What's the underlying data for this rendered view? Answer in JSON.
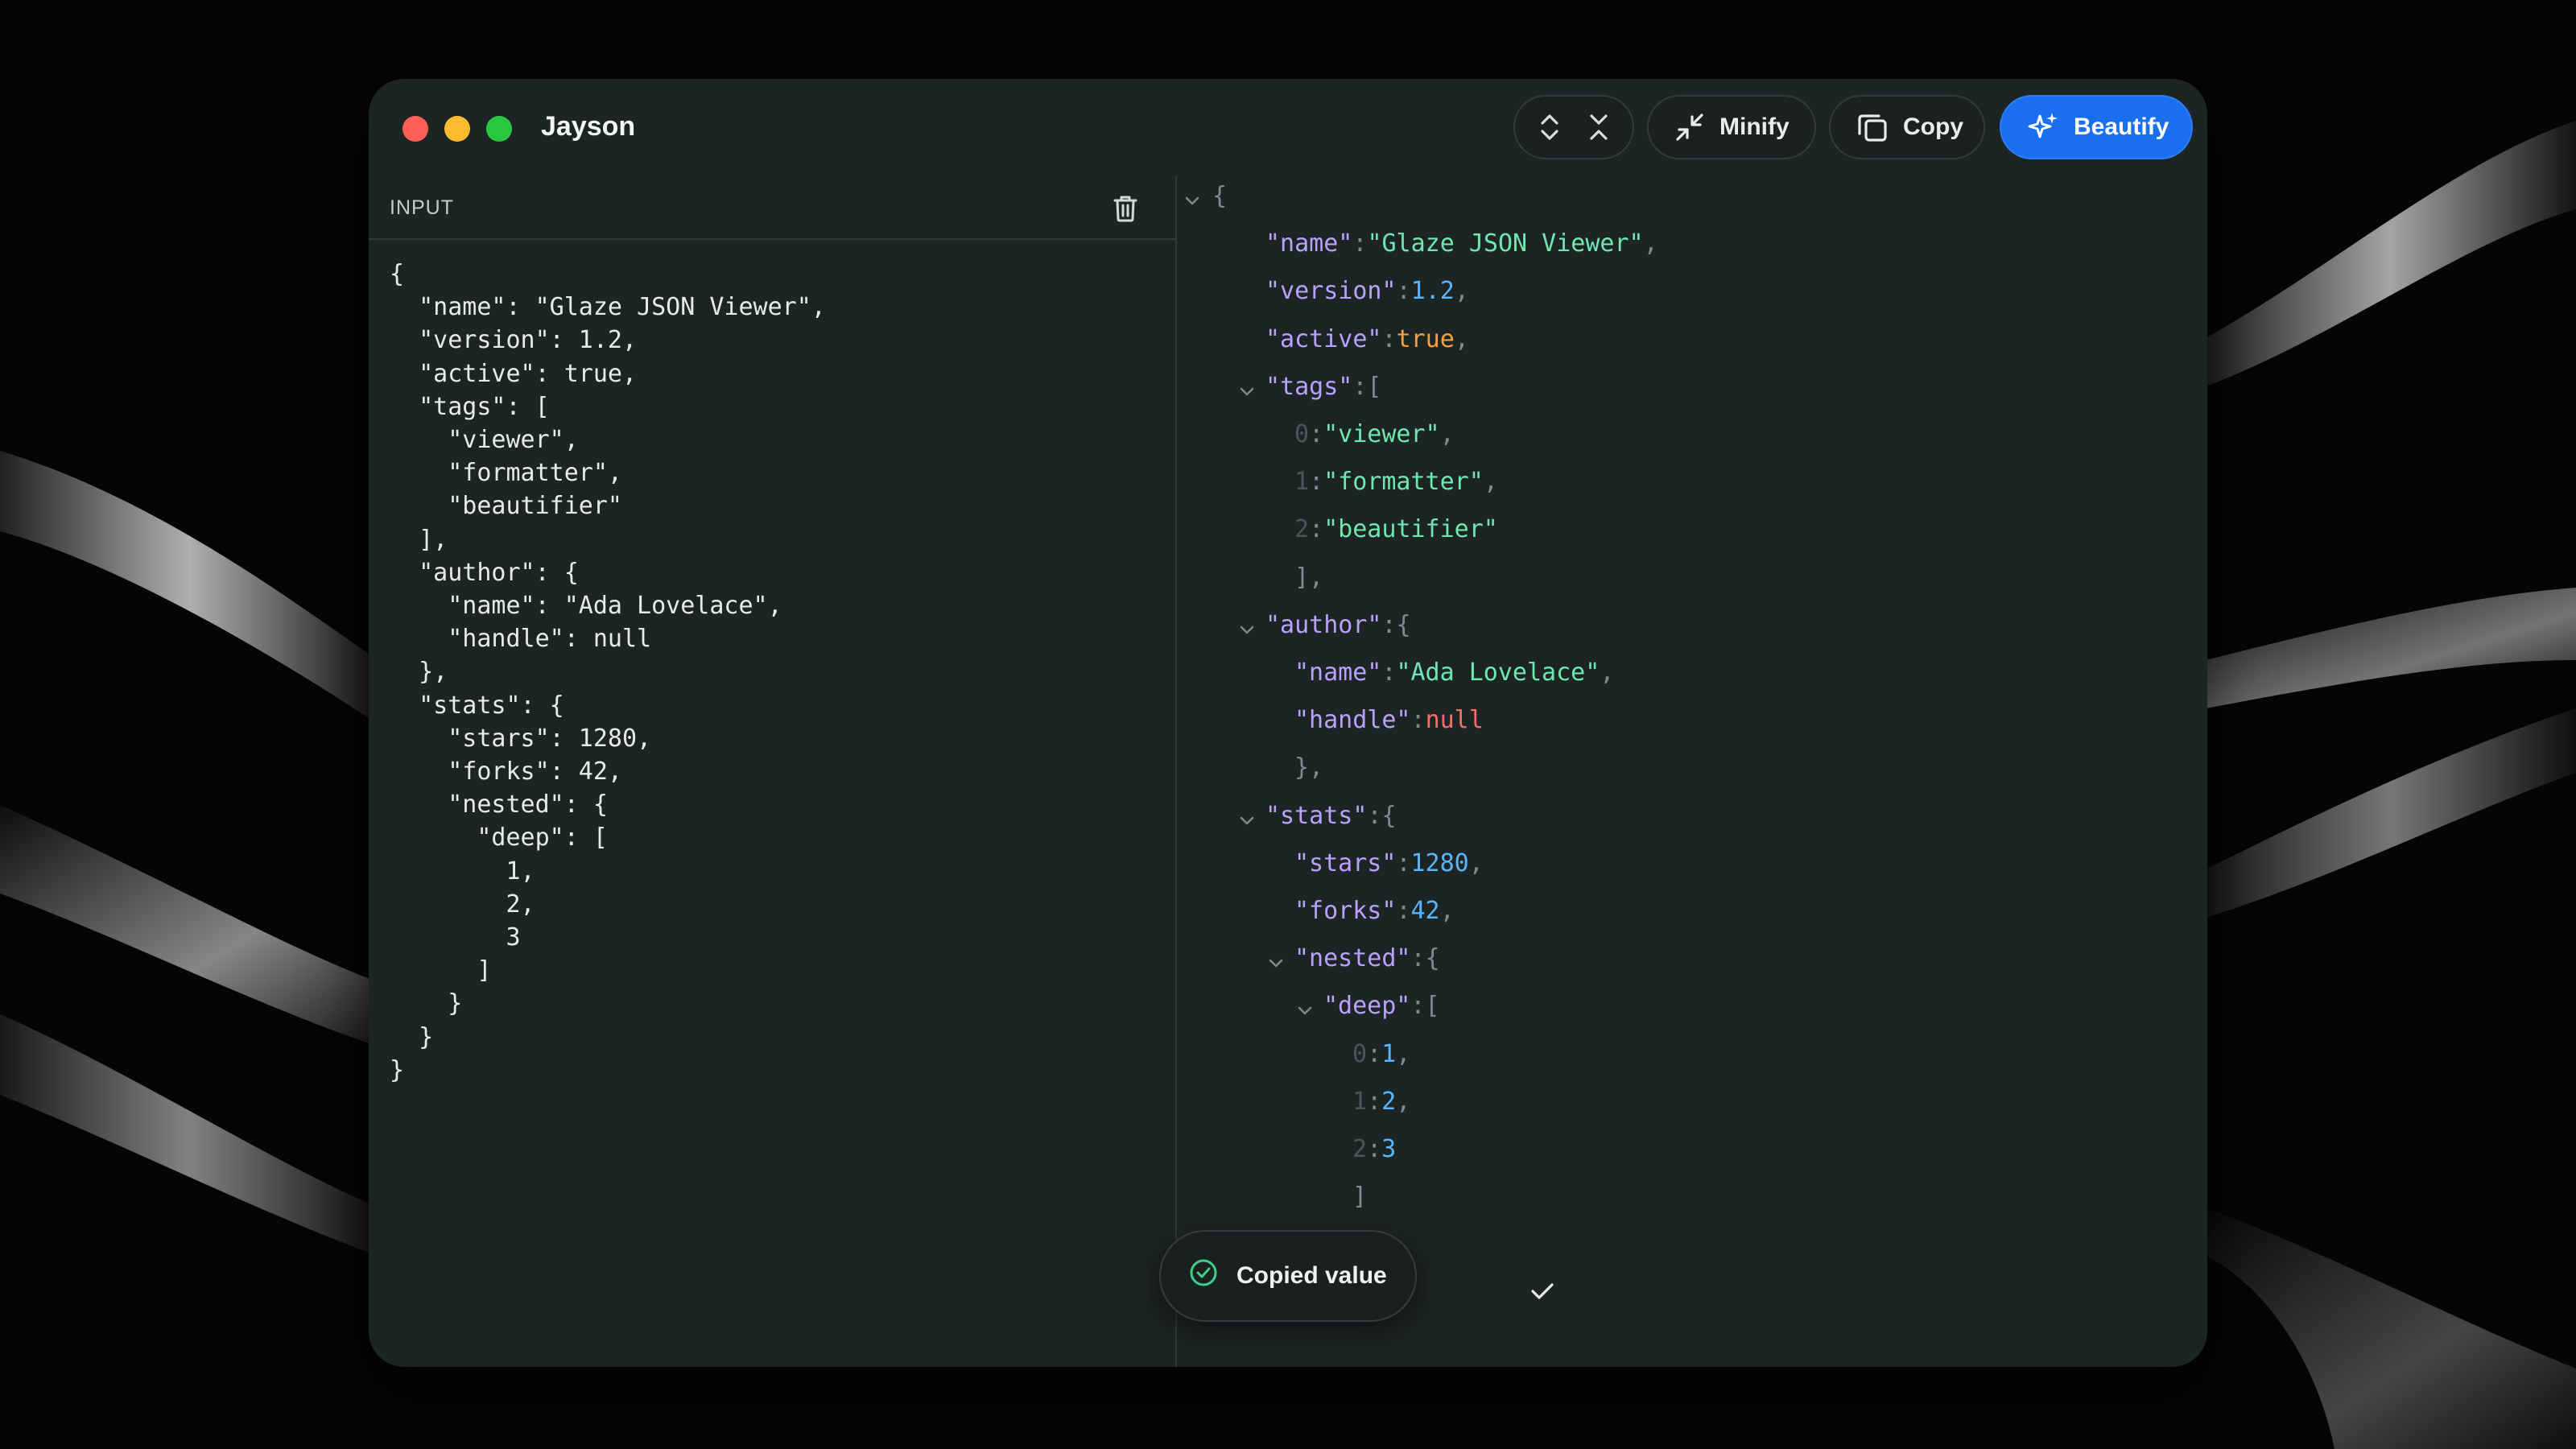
{
  "app": {
    "title": "Jayson"
  },
  "toolbar": {
    "expand_icon": "chevrons-expand-icon",
    "collapse_icon": "chevrons-collapse-icon",
    "minify_label": "Minify",
    "copy_label": "Copy",
    "beautify_label": "Beautify",
    "accent_color": "#1a6ff0"
  },
  "input": {
    "label": "INPUT",
    "lines": [
      "{",
      "  \"name\": \"Glaze JSON Viewer\",",
      "  \"version\": 1.2,",
      "  \"active\": true,",
      "  \"tags\": [",
      "    \"viewer\",",
      "    \"formatter\",",
      "    \"beautifier\"",
      "  ],",
      "  \"author\": {",
      "    \"name\": \"Ada Lovelace\",",
      "    \"handle\": null",
      "  },",
      "  \"stats\": {",
      "    \"stars\": 1280,",
      "    \"forks\": 42,",
      "    \"nested\": {",
      "      \"deep\": [",
      "        1,",
      "        2,",
      "        3",
      "      ]",
      "    }",
      "  }",
      "}"
    ]
  },
  "tree": [
    {
      "depth": 0,
      "chevron": true,
      "parts": [
        [
          "p",
          "{"
        ]
      ]
    },
    {
      "depth": 1,
      "parts": [
        [
          "k",
          "\"name\""
        ],
        [
          "p",
          ":"
        ],
        [
          "s",
          "\"Glaze JSON Viewer\""
        ],
        [
          "p",
          ","
        ]
      ]
    },
    {
      "depth": 1,
      "parts": [
        [
          "k",
          "\"version\""
        ],
        [
          "p",
          ":"
        ],
        [
          "n",
          "1.2"
        ],
        [
          "p",
          ","
        ]
      ]
    },
    {
      "depth": 1,
      "parts": [
        [
          "k",
          "\"active\""
        ],
        [
          "p",
          ":"
        ],
        [
          "b",
          "true"
        ],
        [
          "p",
          ","
        ]
      ]
    },
    {
      "depth": 1,
      "chevron": true,
      "parts": [
        [
          "k",
          "\"tags\""
        ],
        [
          "p",
          ":["
        ]
      ]
    },
    {
      "depth": 2,
      "parts": [
        [
          "idx",
          "0"
        ],
        [
          "p",
          ":"
        ],
        [
          "s",
          "\"viewer\""
        ],
        [
          "p",
          ","
        ]
      ]
    },
    {
      "depth": 2,
      "parts": [
        [
          "idx",
          "1"
        ],
        [
          "p",
          ":"
        ],
        [
          "s",
          "\"formatter\""
        ],
        [
          "p",
          ","
        ]
      ]
    },
    {
      "depth": 2,
      "parts": [
        [
          "idx",
          "2"
        ],
        [
          "p",
          ":"
        ],
        [
          "s",
          "\"beautifier\""
        ]
      ]
    },
    {
      "depth": 2,
      "close": true,
      "parts": [
        [
          "p",
          "],"
        ]
      ]
    },
    {
      "depth": 1,
      "chevron": true,
      "parts": [
        [
          "k",
          "\"author\""
        ],
        [
          "p",
          ":{"
        ]
      ]
    },
    {
      "depth": 2,
      "parts": [
        [
          "k",
          "\"name\""
        ],
        [
          "p",
          ":"
        ],
        [
          "s",
          "\"Ada Lovelace\""
        ],
        [
          "p",
          ","
        ]
      ]
    },
    {
      "depth": 2,
      "parts": [
        [
          "k",
          "\"handle\""
        ],
        [
          "p",
          ":"
        ],
        [
          "nl",
          "null"
        ]
      ]
    },
    {
      "depth": 2,
      "close": true,
      "parts": [
        [
          "p",
          "},"
        ]
      ]
    },
    {
      "depth": 1,
      "chevron": true,
      "parts": [
        [
          "k",
          "\"stats\""
        ],
        [
          "p",
          ":{"
        ]
      ]
    },
    {
      "depth": 2,
      "parts": [
        [
          "k",
          "\"stars\""
        ],
        [
          "p",
          ":"
        ],
        [
          "n",
          "1280"
        ],
        [
          "p",
          ","
        ]
      ]
    },
    {
      "depth": 2,
      "parts": [
        [
          "k",
          "\"forks\""
        ],
        [
          "p",
          ":"
        ],
        [
          "n",
          "42"
        ],
        [
          "p",
          ","
        ]
      ]
    },
    {
      "depth": 2,
      "chevron": true,
      "parts": [
        [
          "k",
          "\"nested\""
        ],
        [
          "p",
          ":{"
        ]
      ]
    },
    {
      "depth": 3,
      "chevron": true,
      "parts": [
        [
          "k",
          "\"deep\""
        ],
        [
          "p",
          ":["
        ]
      ]
    },
    {
      "depth": 4,
      "parts": [
        [
          "idx",
          "0"
        ],
        [
          "p",
          ":"
        ],
        [
          "n",
          "1"
        ],
        [
          "p",
          ","
        ]
      ]
    },
    {
      "depth": 4,
      "parts": [
        [
          "idx",
          "1"
        ],
        [
          "p",
          ":"
        ],
        [
          "n",
          "2"
        ],
        [
          "p",
          ","
        ]
      ]
    },
    {
      "depth": 4,
      "parts": [
        [
          "idx",
          "2"
        ],
        [
          "p",
          ":"
        ],
        [
          "n",
          "3"
        ]
      ]
    },
    {
      "depth": 4,
      "close": true,
      "parts": [
        [
          "p",
          "]"
        ]
      ]
    },
    {
      "depth": 3,
      "close": true,
      "parts": [
        [
          "p",
          "}"
        ]
      ]
    }
  ],
  "toast": {
    "message": "Copied value"
  }
}
